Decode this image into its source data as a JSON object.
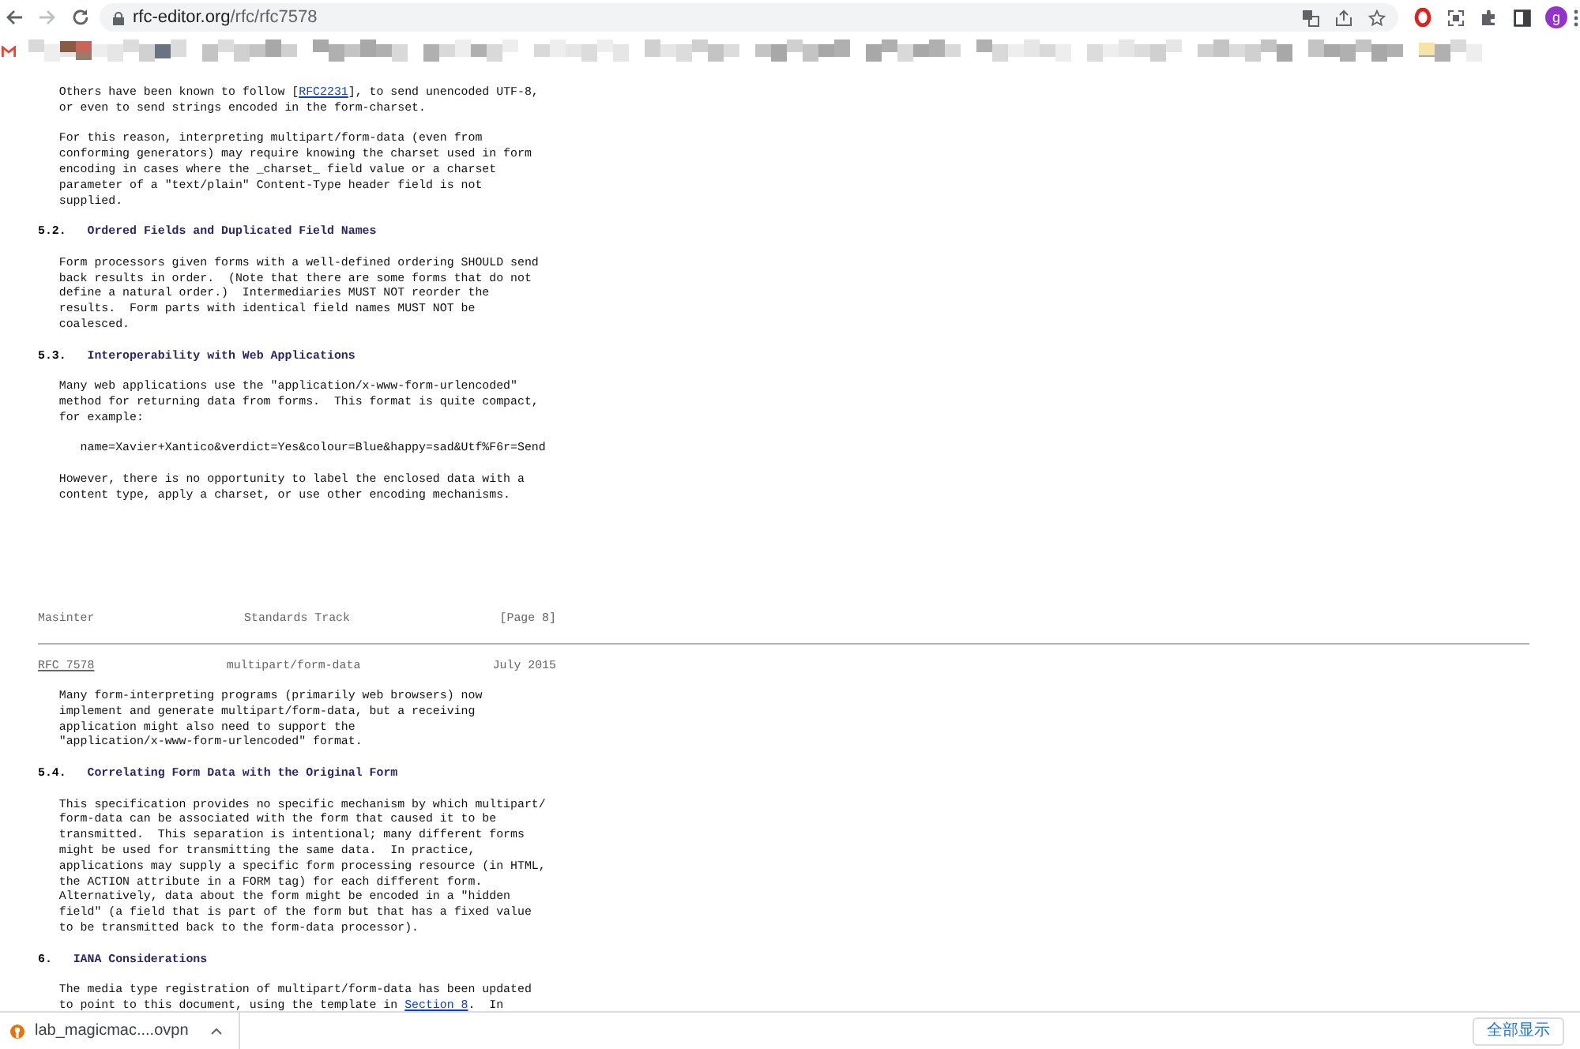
{
  "browser": {
    "url_host": "rfc-editor.org",
    "url_path": "/rfc/rfc7578",
    "avatar": "g"
  },
  "document": {
    "blocks": [
      {
        "kind": "para",
        "lines": [
          [
            {
              "text": "Others have been known to follow ["
            },
            {
              "text": "RFC2231",
              "link": true
            },
            {
              "text": "], to send unencoded UTF-8,"
            }
          ],
          "or even to send strings encoded in the form-charset."
        ]
      },
      {
        "kind": "para",
        "lines": [
          "For this reason, interpreting multipart/form-data (even from",
          "conforming generators) may require knowing the charset used in form",
          "encoding in cases where the _charset_ field value or a charset",
          "parameter of a \"text/plain\" Content-Type header field is not",
          "supplied."
        ]
      },
      {
        "kind": "heading",
        "number": "5.2.",
        "title": "Ordered Fields and Duplicated Field Names"
      },
      {
        "kind": "para",
        "lines": [
          "Form processors given forms with a well-defined ordering SHOULD send",
          "back results in order.  (Note that there are some forms that do not",
          "define a natural order.)  Intermediaries MUST NOT reorder the",
          "results.  Form parts with identical field names MUST NOT be",
          "coalesced."
        ]
      },
      {
        "kind": "heading",
        "number": "5.3.",
        "title": "Interoperability with Web Applications"
      },
      {
        "kind": "para",
        "lines": [
          "Many web applications use the \"application/x-www-form-urlencoded\"",
          "method for returning data from forms.  This format is quite compact,",
          "for example:"
        ]
      },
      {
        "kind": "code",
        "lines": [
          "name=Xavier+Xantico&verdict=Yes&colour=Blue&happy=sad&Utf%F6r=Send"
        ]
      },
      {
        "kind": "para",
        "lines": [
          "However, there is no opportunity to label the enclosed data with a",
          "content type, apply a charset, or use other encoding mechanisms."
        ]
      },
      {
        "kind": "footer",
        "left": "Masinter",
        "center": "Standards Track",
        "right": "[Page 8]"
      },
      {
        "kind": "page_break"
      },
      {
        "kind": "header",
        "left": "RFC 7578",
        "center": "multipart/form-data",
        "right": "July 2015"
      },
      {
        "kind": "para",
        "lines": [
          "Many form-interpreting programs (primarily web browsers) now",
          "implement and generate multipart/form-data, but a receiving",
          "application might also need to support the",
          "\"application/x-www-form-urlencoded\" format."
        ]
      },
      {
        "kind": "heading",
        "number": "5.4.",
        "title": "Correlating Form Data with the Original Form"
      },
      {
        "kind": "para",
        "lines": [
          "This specification provides no specific mechanism by which multipart/",
          "form-data can be associated with the form that caused it to be",
          "transmitted.  This separation is intentional; many different forms",
          "might be used for transmitting the same data.  In practice,",
          "applications may supply a specific form processing resource (in HTML,",
          "the ACTION attribute in a FORM tag) for each different form.",
          "Alternatively, data about the form might be encoded in a \"hidden",
          "field\" (a field that is part of the form but that has a fixed value",
          "to be transmitted back to the form-data processor)."
        ]
      },
      {
        "kind": "heading",
        "number": "6.",
        "title": "IANA Considerations"
      },
      {
        "kind": "para",
        "lines": [
          "The media type registration of multipart/form-data has been updated",
          [
            {
              "text": "to point to this document, using the template in "
            },
            {
              "text": "Section 8",
              "link": true
            },
            {
              "text": ".  In"
            }
          ]
        ]
      }
    ]
  },
  "download_bar": {
    "items": [
      {
        "filename": "lab_magicmac....ovpn"
      }
    ],
    "show_all": "全部显示"
  }
}
